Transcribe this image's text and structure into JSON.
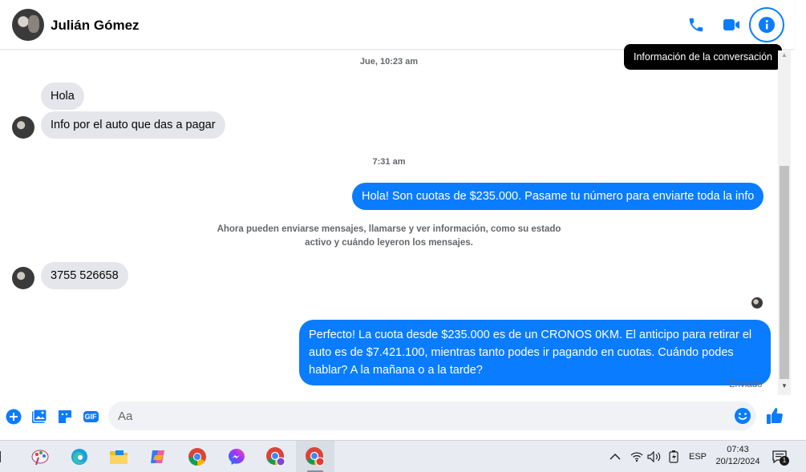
{
  "header": {
    "contact_name": "Julián Gómez",
    "tooltip": "Información de la conversación",
    "icons": [
      "phone-icon",
      "video-icon",
      "info-icon"
    ]
  },
  "messages": {
    "timestamp_1": "Jue, 10:23 am",
    "in_1": "Hola",
    "in_2": "Info por el auto que das a pagar",
    "timestamp_2": "7:31 am",
    "out_1": "Hola! Son cuotas de $235.000. Pasame tu número para enviarte toda la info",
    "system_line_1": "Ahora pueden enviarse mensajes, llamarse y ver información, como su estado",
    "system_line_2": "activo y cuándo leyeron los mensajes.",
    "in_3": "3755 526658",
    "out_2_line_1": "Perfecto! La cuota desde $235.000 es de un CRONOS 0KM. El anticipo para retirar el",
    "out_2_line_2": "auto es de $7.421.100, mientras tanto podes ir pagando en cuotas. Cuándo podes",
    "out_2_line_3": "hablar? A la mañana o a la tarde?",
    "status": "Enviado"
  },
  "composer": {
    "placeholder": "Aa",
    "gif_label": "GIF"
  },
  "taskbar": {
    "language": "ESP",
    "time": "07:43",
    "date": "20/12/2024",
    "notification_count": "1"
  },
  "colors": {
    "accent": "#0a7cff",
    "incoming_bubble": "#e4e6eb",
    "text_secondary": "#65676b"
  }
}
